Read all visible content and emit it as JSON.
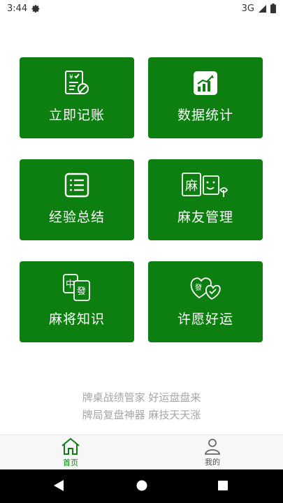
{
  "status": {
    "time": "3:44",
    "network": "3G"
  },
  "tiles": [
    {
      "label": "立即记账"
    },
    {
      "label": "数据统计"
    },
    {
      "label": "经验总结"
    },
    {
      "label": "麻友管理"
    },
    {
      "label": "麻将知识"
    },
    {
      "label": "许愿好运"
    }
  ],
  "tile_glyphs": {
    "mahjong_board": "麻",
    "tile_middle": "中",
    "tile_fa": "發",
    "heart_fa": "發"
  },
  "slogan": {
    "line1": "牌桌战绩管家 好运盘盘来",
    "line2": "牌局复盘神器 麻技天天涨"
  },
  "tabs": [
    {
      "label": "首页",
      "active": true
    },
    {
      "label": "我的",
      "active": false
    }
  ],
  "colors": {
    "accent": "#0c7f10",
    "slogan": "#a6a6a6",
    "tab_active": "#0c7f10",
    "tab_inactive": "#555555"
  }
}
